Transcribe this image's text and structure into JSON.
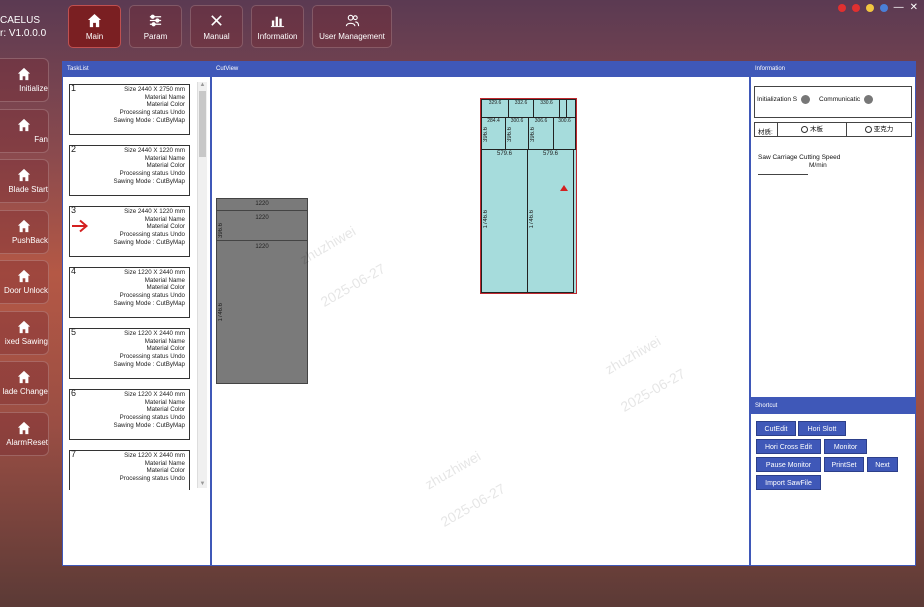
{
  "app": {
    "brand": "CAELUS",
    "version": "r: V1.0.0.0"
  },
  "colors": {
    "accent": "#3f58b8",
    "active_nav": "#7a1f22",
    "sheet_cut": "#a6dcdc",
    "sheet_done": "#7a7a7a"
  },
  "topnav": [
    {
      "label": "Main",
      "icon": "home-icon",
      "active": true
    },
    {
      "label": "Param",
      "icon": "sliders-icon"
    },
    {
      "label": "Manual",
      "icon": "tools-icon"
    },
    {
      "label": "Information",
      "icon": "bar-chart-icon"
    },
    {
      "label": "User Management",
      "icon": "users-icon"
    }
  ],
  "sidebar": [
    {
      "label": "Initialize"
    },
    {
      "label": "Fan"
    },
    {
      "label": "Blade Start"
    },
    {
      "label": "PushBack"
    },
    {
      "label": "Door Unlock"
    },
    {
      "label": "ixed Sawing"
    },
    {
      "label": "lade Change"
    },
    {
      "label": "AlarmReset"
    }
  ],
  "tasklist": {
    "title": "TaskList",
    "items": [
      {
        "num": "1",
        "size": "Size  2440 X 2750 mm",
        "material": "Material Name",
        "color": "Material Color",
        "status": "Processing status  Undo",
        "mode": "Sawing Mode :   CutByMap"
      },
      {
        "num": "2",
        "size": "Size  2440 X 1220 mm",
        "material": "Material Name",
        "color": "Material Color",
        "status": "Processing status  Undo",
        "mode": "Sawing Mode :   CutByMap"
      },
      {
        "num": "3",
        "size": "Size  2440 X 1220 mm",
        "material": "Material Name",
        "color": "Material Color",
        "status": "Processing status  Undo",
        "mode": "Sawing Mode :   CutByMap",
        "current": true
      },
      {
        "num": "4",
        "size": "Size  1220 X 2440 mm",
        "material": "Material Name",
        "color": "Material Color",
        "status": "Processing status  Undo",
        "mode": "Sawing Mode :   CutByMap"
      },
      {
        "num": "5",
        "size": "Size  1220 X 2440 mm",
        "material": "Material Name",
        "color": "Material Color",
        "status": "Processing status  Undo",
        "mode": "Sawing Mode :   CutByMap"
      },
      {
        "num": "6",
        "size": "Size  1220 X 2440 mm",
        "material": "Material Name",
        "color": "Material Color",
        "status": "Processing status  Undo",
        "mode": "Sawing Mode :   CutByMap"
      },
      {
        "num": "7",
        "size": "Size  1220 X 2440 mm",
        "material": "Material Name",
        "color": "Material Color",
        "status": "Processing status  Undo",
        "mode": ""
      }
    ]
  },
  "cutview": {
    "title": "CutView",
    "grey_sheet": {
      "strips": [
        "1220",
        "1220",
        "1220"
      ],
      "side_label_1": "396.6",
      "side_label_2": "1746.6"
    },
    "cyan_sheet": {
      "top_labels": [
        "329.6",
        "332.6",
        "330.6"
      ],
      "mid_labels": [
        "284.4",
        "300.6",
        "306.6",
        "300.6"
      ],
      "side_labels": [
        "396.6",
        "396.6",
        "396.6"
      ],
      "col_widths": [
        "579.6",
        "579.6"
      ],
      "col_heights": [
        "1746.6",
        "1746.6"
      ]
    },
    "watermark_name": "zhuzhiwei",
    "watermark_date": "2025-06-27"
  },
  "information": {
    "title": "Information",
    "init_label": "Initialization S",
    "comm_label": "Communicatic",
    "material_label": "材质:",
    "option_wood": "木板",
    "option_acrylic": "亚克力",
    "speed_label": "Saw Carriage Cutting Speed",
    "speed_unit": "M/min",
    "speed_value": ""
  },
  "shortcut": {
    "title": "Shortcut",
    "buttons": [
      "CutEdit",
      "Hori Slott",
      "Hori Cross Edit",
      "Monitor",
      "Pause Monitor",
      "PrintSet",
      "Next",
      "Import SawFile"
    ]
  }
}
